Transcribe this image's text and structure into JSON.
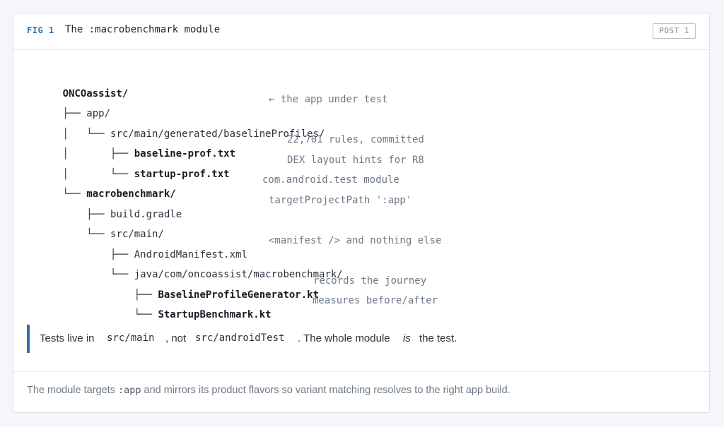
{
  "header": {
    "fig_label": "FIG 1",
    "title": "The :macrobenchmark module",
    "badge": "POST 1"
  },
  "tree": {
    "root": "ONCOassist/",
    "lines": [
      {
        "branch": "├── ",
        "name": "app/",
        "bold": false,
        "comment": "← the app under test"
      },
      {
        "branch": "│   └── ",
        "name": "src/main/generated/baselineProfiles/",
        "bold": false,
        "comment": ""
      },
      {
        "branch": "│       ├── ",
        "name": "baseline-prof.txt",
        "bold": true,
        "comment": "22,701 rules, committed"
      },
      {
        "branch": "│       └── ",
        "name": "startup-prof.txt",
        "bold": true,
        "comment": "DEX layout hints for R8"
      },
      {
        "branch": "└── ",
        "name": "macrobenchmark/",
        "bold": true,
        "comment": "com.android.test module"
      },
      {
        "branch": "    ├── ",
        "name": "build.gradle",
        "bold": false,
        "comment": "targetProjectPath ':app'"
      },
      {
        "branch": "    └── ",
        "name": "src/main/",
        "bold": false,
        "comment": ""
      },
      {
        "branch": "        ├── ",
        "name": "AndroidManifest.xml",
        "bold": false,
        "comment": "<manifest /> and nothing else"
      },
      {
        "branch": "        └── ",
        "name": "java/com/oncoassist/macrobenchmark/",
        "bold": false,
        "comment": ""
      },
      {
        "branch": "            ├── ",
        "name": "BaselineProfileGenerator.kt",
        "bold": true,
        "comment": "records the journey"
      },
      {
        "branch": "            └── ",
        "name": "StartupBenchmark.kt",
        "bold": true,
        "comment": "measures before/after"
      }
    ]
  },
  "callout": {
    "t1": "Tests live in",
    "code1": "src/main",
    "t2": ", not",
    "code2": "src/androidTest",
    "t3": ". The whole module",
    "em": "is",
    "t4": "the test."
  },
  "footer": {
    "t1": "The module targets ",
    "code": ":app",
    "t2": " and mirrors its product flavors so variant matching resolves to the right app build."
  },
  "colors": {
    "accent": "#2a6fb0",
    "text": "#2b333d",
    "muted": "#6d7886",
    "background": "#f4f6f9"
  }
}
